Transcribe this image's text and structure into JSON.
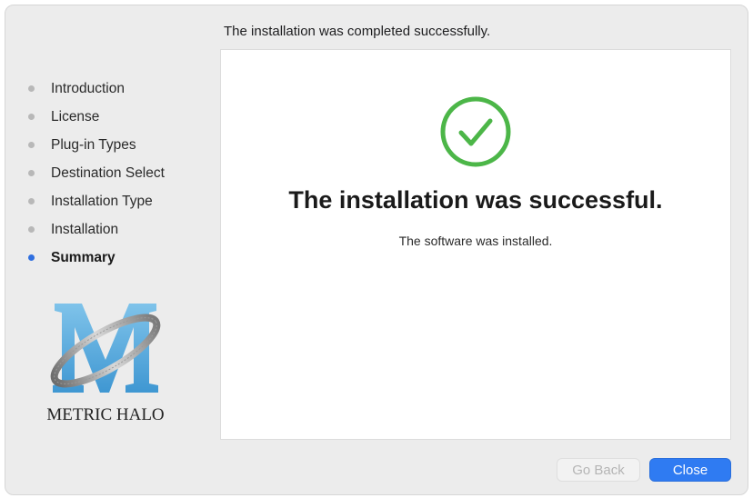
{
  "header": {
    "message": "The installation was completed successfully."
  },
  "sidebar": {
    "steps": [
      {
        "label": "Introduction",
        "active": false
      },
      {
        "label": "License",
        "active": false
      },
      {
        "label": "Plug-in Types",
        "active": false
      },
      {
        "label": "Destination Select",
        "active": false
      },
      {
        "label": "Installation Type",
        "active": false
      },
      {
        "label": "Installation",
        "active": false
      },
      {
        "label": "Summary",
        "active": true
      }
    ]
  },
  "logo": {
    "text": "METRIC HALO",
    "icon": "metric-halo-logo"
  },
  "main": {
    "icon": "checkmark-circle-icon",
    "title": "The installation was successful.",
    "subtitle": "The software was installed."
  },
  "buttons": {
    "back_label": "Go Back",
    "close_label": "Close"
  },
  "colors": {
    "accent": "#2f7bf2",
    "success": "#4cb648",
    "active_dot": "#2f6fe0",
    "inactive_dot": "#b8b8b8"
  }
}
